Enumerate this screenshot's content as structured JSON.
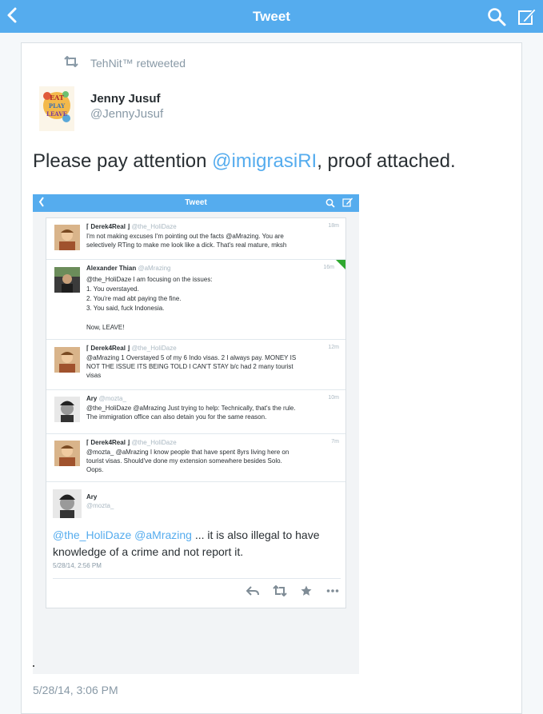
{
  "nav": {
    "title": "Tweet",
    "icons": [
      "chevron-left-icon",
      "search-icon",
      "compose-icon"
    ]
  },
  "colors": {
    "brand": "#55acee",
    "muted": "#8899a6",
    "text": "#292f33"
  },
  "tweet": {
    "retweeted_by": "TehNit™ retweeted",
    "name": "Jenny Jusuf",
    "handle": "@JennyJusuf",
    "text_before": "Please pay attention ",
    "mention": "@imigrasiRI",
    "text_after": ", proof attached.",
    "timestamp": "5/28/14, 3:06 PM",
    "avatar_text": [
      "EAT",
      "PLAY",
      "LEAVE"
    ]
  },
  "embedded": {
    "nav_title": "Tweet",
    "replies": [
      {
        "name": "⌈ Derek4Real ⌋",
        "handle": "@the_HoliDaze",
        "time": "18m",
        "lines": [
          "I'm not making excuses I'm pointing out the facts @aMrazing. You are",
          "selectively RTing to make me look like a dick. That's real mature, mksh"
        ]
      },
      {
        "name": "Alexander Thian",
        "handle": "@aMrazing",
        "time": "16m",
        "lines": [
          "@the_HoliDaze I am focusing on the issues:",
          "1. You overstayed.",
          "2. You're mad abt paying the fine.",
          "3. You said, fuck Indonesia.",
          "",
          "Now, LEAVE!"
        ]
      },
      {
        "name": "⌈ Derek4Real ⌋",
        "handle": "@the_HoliDaze",
        "time": "12m",
        "lines": [
          "@aMrazing 1 Overstayed 5 of my 6 Indo visas. 2 I always pay. MONEY IS",
          "NOT THE ISSUE ITS BEING TOLD I CAN'T STAY b/c had 2 many tourist",
          "visas"
        ]
      },
      {
        "name": "Ary",
        "handle": "@mozta_",
        "time": "10m",
        "lines": [
          "@the_HoliDaze @aMrazing Just trying to help: Technically, that's the rule.",
          "The immigration office can also detain you for the same reason."
        ]
      },
      {
        "name": "⌈ Derek4Real ⌋",
        "handle": "@the_HoliDaze",
        "time": "7m",
        "lines": [
          "@mozta_ @aMrazing I know people that have spent 8yrs living here on",
          "tourist visas. Should've done my extension somewhere besides Solo.",
          "Oops."
        ]
      }
    ],
    "focus": {
      "name": "Ary",
      "handle": "@mozta_",
      "mention1": "@the_HoliDaze",
      "mention2": "@aMrazing",
      "text_line1": " ... it is also illegal to have",
      "text_line2": "knowledge of a crime and not report it.",
      "date": "5/28/14, 2:56 PM",
      "actions": [
        "reply-icon",
        "retweet-icon",
        "favorite-icon",
        "more-icon"
      ]
    }
  }
}
